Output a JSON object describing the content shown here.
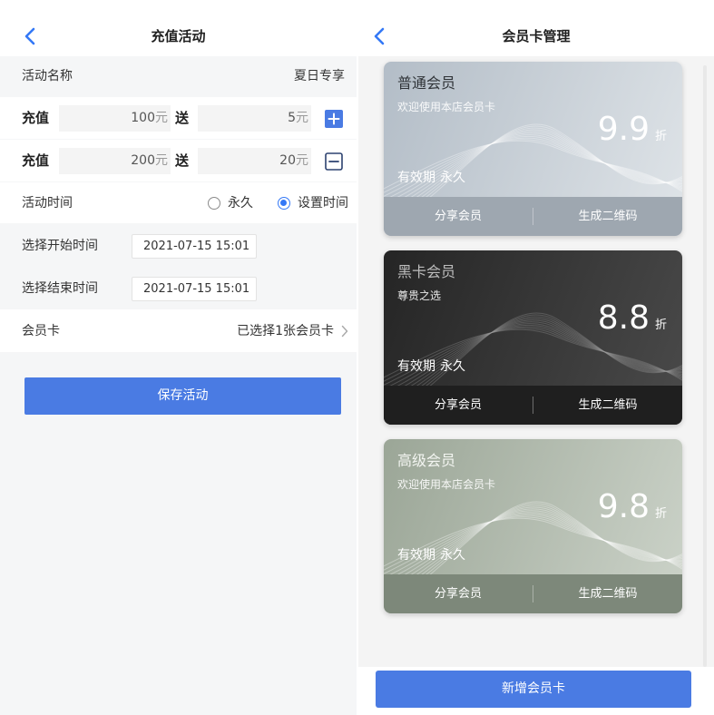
{
  "colors": {
    "accent": "#4a7be3",
    "back_icon": "#3478f6",
    "minus_border": "#2d4270"
  },
  "left": {
    "title": "充值活动",
    "activity_name": {
      "label": "活动名称",
      "value": "夏日专享"
    },
    "recharge_rules": [
      {
        "label": "充值",
        "amount": "100",
        "amount_unit": "元",
        "give_label": "送",
        "bonus": "5",
        "bonus_unit": "元",
        "action_icon": "plus-icon"
      },
      {
        "label": "充值",
        "amount": "200",
        "amount_unit": "元",
        "give_label": "送",
        "bonus": "20",
        "bonus_unit": "元",
        "action_icon": "minus-icon"
      }
    ],
    "activity_time": {
      "label": "活动时间",
      "options": [
        {
          "label": "永久",
          "selected": false
        },
        {
          "label": "设置时间",
          "selected": true
        }
      ]
    },
    "start_time": {
      "label": "选择开始时间",
      "value": "2021-07-15 15:01"
    },
    "end_time": {
      "label": "选择结束时间",
      "value": "2021-07-15 15:01"
    },
    "member_card": {
      "label": "会员卡",
      "value": "已选择1张会员卡"
    },
    "save_label": "保存活动"
  },
  "right": {
    "title": "会员卡管理",
    "cards": [
      {
        "name": "普通会员",
        "subtitle": "欢迎使用本店会员卡",
        "discount": "9.9",
        "discount_unit": "折",
        "validity_label": "有效期",
        "validity": "永久",
        "share_label": "分享会员",
        "qrcode_label": "生成二维码",
        "colors": {
          "from": "#b3bdc7",
          "to": "#dfe4e8",
          "bar": "#9ea7b0",
          "name": "#2f3337",
          "wave": "#ffffff"
        }
      },
      {
        "name": "黑卡会员",
        "subtitle": "尊贵之选",
        "discount": "8.8",
        "discount_unit": "折",
        "validity_label": "有效期",
        "validity": "永久",
        "share_label": "分享会员",
        "qrcode_label": "生成二维码",
        "colors": {
          "from": "#252525",
          "to": "#4a4a4a",
          "bar": "#1f1f1f",
          "name": "#bdbdbd",
          "wave": "#9a9a9a"
        }
      },
      {
        "name": "高级会员",
        "subtitle": "欢迎使用本店会员卡",
        "discount": "9.8",
        "discount_unit": "折",
        "validity_label": "有效期",
        "validity": "永久",
        "share_label": "分享会员",
        "qrcode_label": "生成二维码",
        "colors": {
          "from": "#9ba697",
          "to": "#ccd3c9",
          "bar": "#7d887a",
          "name": "#f3f5f1",
          "wave": "#ffffff"
        }
      }
    ],
    "add_label": "新增会员卡"
  }
}
